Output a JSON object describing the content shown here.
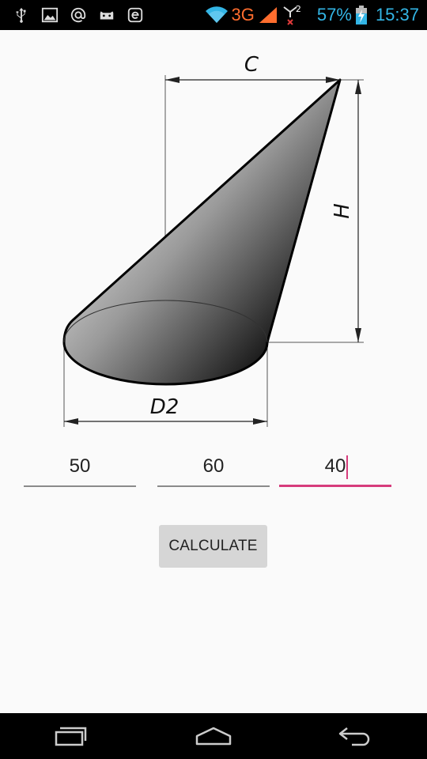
{
  "status_bar": {
    "icons": [
      "usb-icon",
      "image-icon",
      "at-icon",
      "game-controller-icon",
      "e-app-icon",
      "wifi-icon",
      "signal-icon",
      "sim2-signal-icon",
      "battery-charging-icon"
    ],
    "network_type": "3G",
    "sim_label": "2",
    "battery_percent": "57%",
    "time": "15:37"
  },
  "drawing": {
    "labels": {
      "c": "C",
      "h": "H",
      "d2": "D2"
    }
  },
  "inputs": [
    {
      "id": "d2",
      "value": "50",
      "focused": false
    },
    {
      "id": "h",
      "value": "60",
      "focused": false
    },
    {
      "id": "c",
      "value": "40",
      "focused": true
    }
  ],
  "calculate_button": {
    "label": "CALCULATE"
  },
  "nav_bar": {
    "icons": [
      "recent-apps-icon",
      "home-icon",
      "back-icon"
    ]
  },
  "colors": {
    "accent": "#d63c7c",
    "status_text": "#33b5e5",
    "network_type": "#ff6d2e"
  }
}
